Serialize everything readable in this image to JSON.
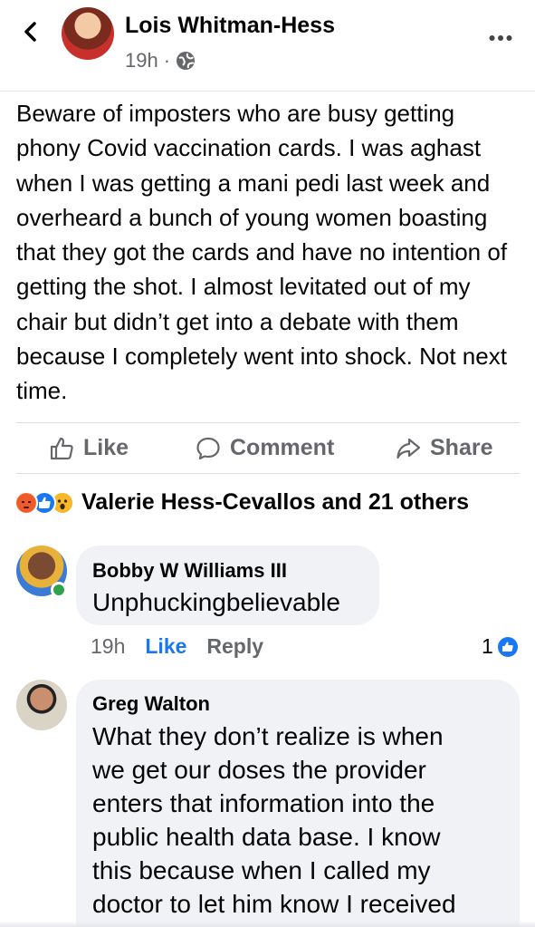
{
  "post": {
    "author": "Lois Whitman-Hess",
    "time": "19h",
    "separator": "·",
    "body": "Beware of imposters who are busy getting phony Covid vaccination cards. I was aghast when I was getting a mani pedi last week and overheard a bunch of young women boasting that they got the cards and have no intention of getting the shot. I almost levitated out of my chair but didn’t get into a debate with them because I completely went into shock. Not next time."
  },
  "actions": {
    "like": "Like",
    "comment": "Comment",
    "share": "Share"
  },
  "reactions": {
    "summary": "Valerie Hess-Cevallos and 21 others",
    "icons": [
      "angry-reaction-icon",
      "like-reaction-icon",
      "wow-reaction-icon"
    ]
  },
  "comments": [
    {
      "name": "Bobby W Williams III",
      "text": "Unphuckingbelievable",
      "time": "19h",
      "like_label": "Like",
      "reply_label": "Reply",
      "reaction_count": "1",
      "online": true
    },
    {
      "name": "Greg Walton",
      "lines": [
        "What they don’t realize is when",
        "we get our doses the provider",
        "enters that information into the",
        "public health data base. I know",
        "this because when I called my",
        "doctor to let him know I received"
      ]
    }
  ],
  "colors": {
    "accent": "#1877f2",
    "muted": "#65676b",
    "bubble": "#f0f2f5"
  }
}
